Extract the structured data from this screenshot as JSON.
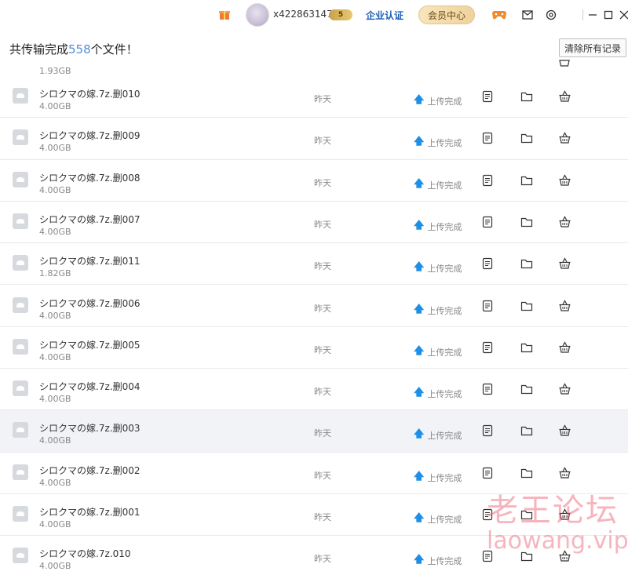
{
  "topbar": {
    "username": "x422863147",
    "vip_level": "5",
    "enterprise_label": "企业认证",
    "member_center_label": "会员中心"
  },
  "header": {
    "title_prefix": "共传输完成",
    "count": "558",
    "title_suffix": "个文件！",
    "clear_button": "清除所有记录"
  },
  "partial_row": {
    "size": "1.93GB"
  },
  "rows": [
    {
      "name": "シロクマの嫁.7z.删010",
      "size": "4.00GB",
      "date": "昨天",
      "status": "上传完成"
    },
    {
      "name": "シロクマの嫁.7z.删009",
      "size": "4.00GB",
      "date": "昨天",
      "status": "上传完成"
    },
    {
      "name": "シロクマの嫁.7z.删008",
      "size": "4.00GB",
      "date": "昨天",
      "status": "上传完成"
    },
    {
      "name": "シロクマの嫁.7z.删007",
      "size": "4.00GB",
      "date": "昨天",
      "status": "上传完成"
    },
    {
      "name": "シロクマの嫁.7z.删011",
      "size": "1.82GB",
      "date": "昨天",
      "status": "上传完成"
    },
    {
      "name": "シロクマの嫁.7z.删006",
      "size": "4.00GB",
      "date": "昨天",
      "status": "上传完成"
    },
    {
      "name": "シロクマの嫁.7z.删005",
      "size": "4.00GB",
      "date": "昨天",
      "status": "上传完成"
    },
    {
      "name": "シロクマの嫁.7z.删004",
      "size": "4.00GB",
      "date": "昨天",
      "status": "上传完成"
    },
    {
      "name": "シロクマの嫁.7z.删003",
      "size": "4.00GB",
      "date": "昨天",
      "status": "上传完成"
    },
    {
      "name": "シロクマの嫁.7z.删002",
      "size": "4.00GB",
      "date": "昨天",
      "status": "上传完成"
    },
    {
      "name": "シロクマの嫁.7z.删001",
      "size": "4.00GB",
      "date": "昨天",
      "status": "上传完成"
    },
    {
      "name": "シロクマの嫁.7z.010",
      "size": "4.00GB",
      "date": "昨天",
      "status": "上传完成"
    }
  ],
  "highlighted_row": 8,
  "watermark": {
    "text": "老王论坛",
    "url": "laowang.vip"
  },
  "colors": {
    "accent": "#4f8ed8",
    "upload_arrow": "#1e8fe6",
    "member_gold": "#efd29c"
  }
}
